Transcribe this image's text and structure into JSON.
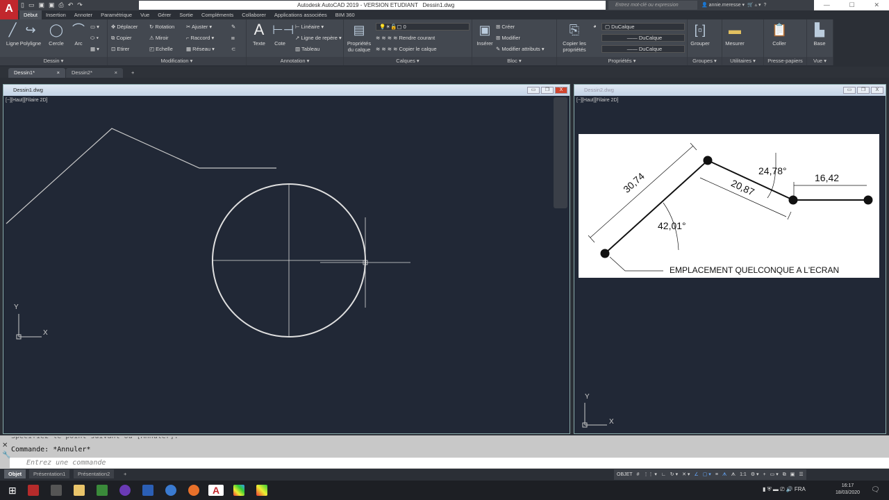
{
  "app": {
    "title": "Autodesk AutoCAD 2019 - VERSION ETUDIANT",
    "file": "Dessin1.dwg",
    "search_placeholder": "Entrez mot-clé ou expression",
    "user": "annie.meresse",
    "logo": "A"
  },
  "ribbon_tabs": [
    "Début",
    "Insertion",
    "Annoter",
    "Paramétrique",
    "Vue",
    "Gérer",
    "Sortie",
    "Compléments",
    "Collaborer",
    "Applications associées",
    "BIM 360"
  ],
  "ribbon": {
    "dessin": {
      "label": "Dessin",
      "ligne": "Ligne",
      "polyligne": "Polyligne",
      "cercle": "Cercle",
      "arc": "Arc"
    },
    "modification": {
      "label": "Modification",
      "deplacer": "Déplacer",
      "rotation": "Rotation",
      "ajuster": "Ajuster",
      "copier": "Copier",
      "miroir": "Miroir",
      "raccord": "Raccord",
      "etirer": "Etirer",
      "echelle": "Echelle",
      "reseau": "Réseau"
    },
    "annotation": {
      "label": "Annotation",
      "texte": "Texte",
      "cote": "Cote",
      "lineaire": "Linéaire",
      "ligne_repere": "Ligne de repère",
      "tableau": "Tableau"
    },
    "calques": {
      "label": "Calques",
      "proprietes": "Propriétés du calque",
      "layer": "0",
      "rendre_courant": "Rendre courant",
      "copier_calque": "Copier le calque"
    },
    "bloc": {
      "label": "Bloc",
      "inserer": "Insérer",
      "creer": "Créer",
      "modifier": "Modifier",
      "modifier_attributs": "Modifier attributs"
    },
    "proprietes": {
      "label": "Propriétés",
      "copier": "Copier les propriétés",
      "color": "DuCalque",
      "linetype": "DuCalque",
      "lineweight": "DuCalque"
    },
    "groupes": {
      "label": "Groupes",
      "grouper": "Grouper"
    },
    "utilitaires": {
      "label": "Utilitaires",
      "mesurer": "Mesurer"
    },
    "presse": {
      "label": "Presse-papiers",
      "coller": "Coller"
    },
    "vue": {
      "label": "Vue",
      "base": "Base"
    }
  },
  "doc_tabs": [
    "Dessin1*",
    "Dessin2*"
  ],
  "windows": [
    {
      "title": "Dessin1.dwg",
      "viewport": "[−][Haut][Filaire 2D]"
    },
    {
      "title": "Dessin2.dwg",
      "viewport": "[−][Haut][Filaire 2D]"
    }
  ],
  "ucs": {
    "x": "X",
    "y": "Y"
  },
  "reference": {
    "dim1": "30,74",
    "dim2": "20,87",
    "dim3": "16,42",
    "angle1": "42,01°",
    "angle2": "24,78°",
    "note": "EMPLACEMENT QUELCONQUE A L'ECRAN"
  },
  "command": {
    "history1": "Spécifiez le point suivant ou [Annuler]:",
    "history2": "Commande: *Annuler*",
    "placeholder": "Entrez une commande"
  },
  "layout_tabs": [
    "Objet",
    "Présentation1",
    "Présentation2"
  ],
  "status": {
    "mode": "OBJET",
    "scale": "1:1"
  },
  "tray": {
    "lang": "FRA",
    "time": "16:17",
    "date": "18/03/2020"
  }
}
